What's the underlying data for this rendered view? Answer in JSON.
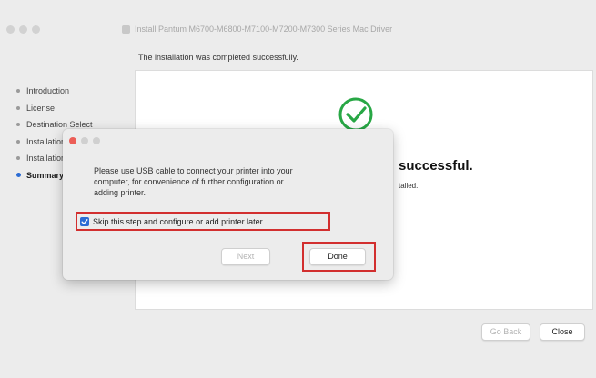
{
  "window": {
    "title": "Install Pantum M6700-M6800-M7100-M7200-M7300 Series Mac Driver",
    "subtitle": "The installation was completed successfully."
  },
  "sidebar": {
    "items": [
      {
        "label": "Introduction",
        "active": false
      },
      {
        "label": "License",
        "active": false
      },
      {
        "label": "Destination Select",
        "active": false
      },
      {
        "label": "Installation Type",
        "active": false
      },
      {
        "label": "Installation",
        "active": false
      },
      {
        "label": "Summary",
        "active": true
      }
    ]
  },
  "main": {
    "status_icon": "check-circle-icon",
    "success_heading": "successful.",
    "success_sub": "talled."
  },
  "footer": {
    "go_back_label": "Go Back",
    "close_label": "Close"
  },
  "dialog": {
    "message_lines": [
      "Please use USB cable to connect your printer into your",
      "computer, for convenience of further configuration or",
      "adding printer."
    ],
    "skip_label": "Skip this step and configure or add printer later.",
    "skip_checked": true,
    "next_label": "Next",
    "done_label": "Done"
  },
  "colors": {
    "accent": "#2b6cd4",
    "success_green": "#28a745",
    "highlight_red": "#d22f2f",
    "dialog_close": "#ec5e57",
    "dialog_disabled": "#d0d0d0"
  }
}
